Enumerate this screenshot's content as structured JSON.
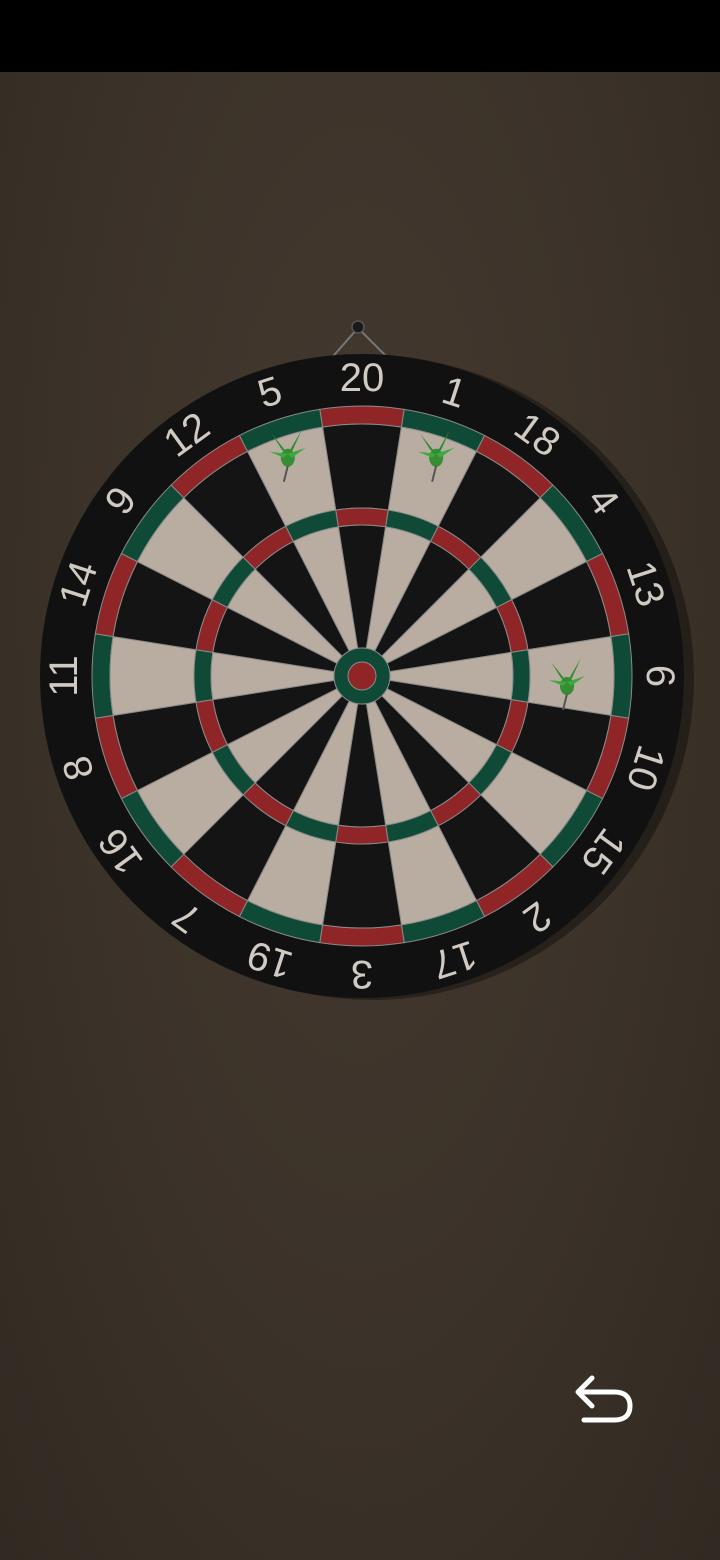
{
  "board": {
    "numbers": [
      20,
      1,
      18,
      4,
      13,
      6,
      10,
      15,
      2,
      17,
      3,
      19,
      7,
      16,
      8,
      11,
      14,
      9,
      12,
      5
    ],
    "colors": {
      "outer_ring": "#111111",
      "segment_dark": "#141414",
      "segment_light": "#b9ada1",
      "ring_red": "#8f2527",
      "ring_green": "#0f4a36",
      "number_text": "#d0cac2",
      "wire": "#8a8a8a"
    }
  },
  "darts": [
    {
      "segment": "5",
      "ring": "double",
      "color": "#2e8b2e"
    },
    {
      "segment": "1",
      "ring": "double",
      "color": "#2e8b2e"
    },
    {
      "segment": "6",
      "ring": "single",
      "color": "#2e8b2e"
    }
  ],
  "controls": {
    "undo_icon": "undo-arrow-icon"
  }
}
